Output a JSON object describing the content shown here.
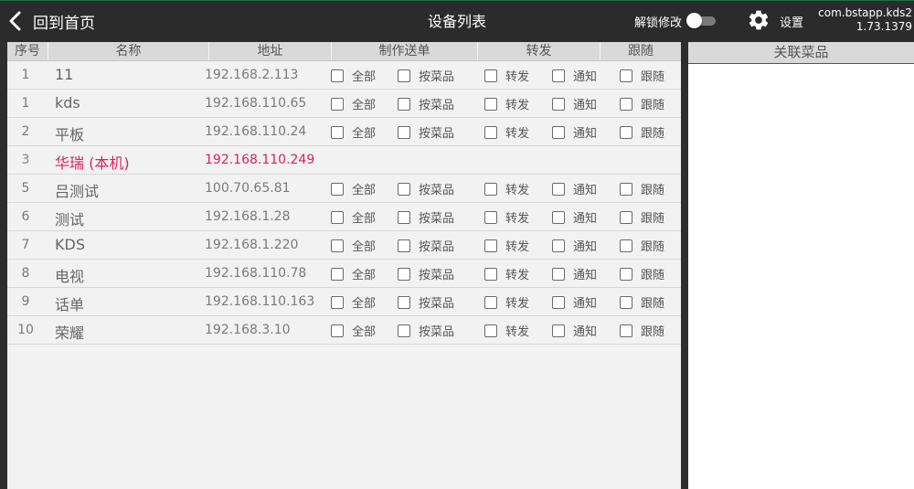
{
  "topbar": {
    "back_label": "回到首页",
    "title": "设备列表",
    "unlock_label": "解锁修改",
    "settings_label": "设置",
    "app_id": "com.bstapp.kds2",
    "app_version": "1.73.1379"
  },
  "table": {
    "headers": {
      "index": "序号",
      "name": "名称",
      "address": "地址",
      "make_send": "制作送单",
      "forward": "转发",
      "follow": "跟随"
    },
    "checkbox_labels": {
      "all": "全部",
      "by_dish": "按菜品",
      "forward": "转发",
      "notify": "通知",
      "follow": "跟随"
    },
    "rows": [
      {
        "num": "1",
        "name": "11",
        "addr": "192.168.2.113"
      },
      {
        "num": "1",
        "name": "kds",
        "addr": "192.168.110.65"
      },
      {
        "num": "2",
        "name": "平板",
        "addr": "192.168.110.24"
      },
      {
        "num": "3",
        "name": "华瑞 (本机)",
        "addr": "192.168.110.249"
      },
      {
        "num": "5",
        "name": "吕测试",
        "addr": "100.70.65.81"
      },
      {
        "num": "6",
        "name": "测试",
        "addr": "192.168.1.28"
      },
      {
        "num": "7",
        "name": "KDS",
        "addr": "192.168.1.220"
      },
      {
        "num": "8",
        "name": "电视",
        "addr": "192.168.110.78"
      },
      {
        "num": "9",
        "name": "话单",
        "addr": "192.168.110.163"
      },
      {
        "num": "10",
        "name": "荣耀",
        "addr": "192.168.3.10"
      }
    ]
  },
  "related_panel": {
    "title": "关联菜品"
  },
  "colors": {
    "topbar_bg": "#2b2b2b",
    "panel_bg": "#f2f2f2",
    "header_bg": "#d9d9d9",
    "local_device": "#e0205a"
  }
}
